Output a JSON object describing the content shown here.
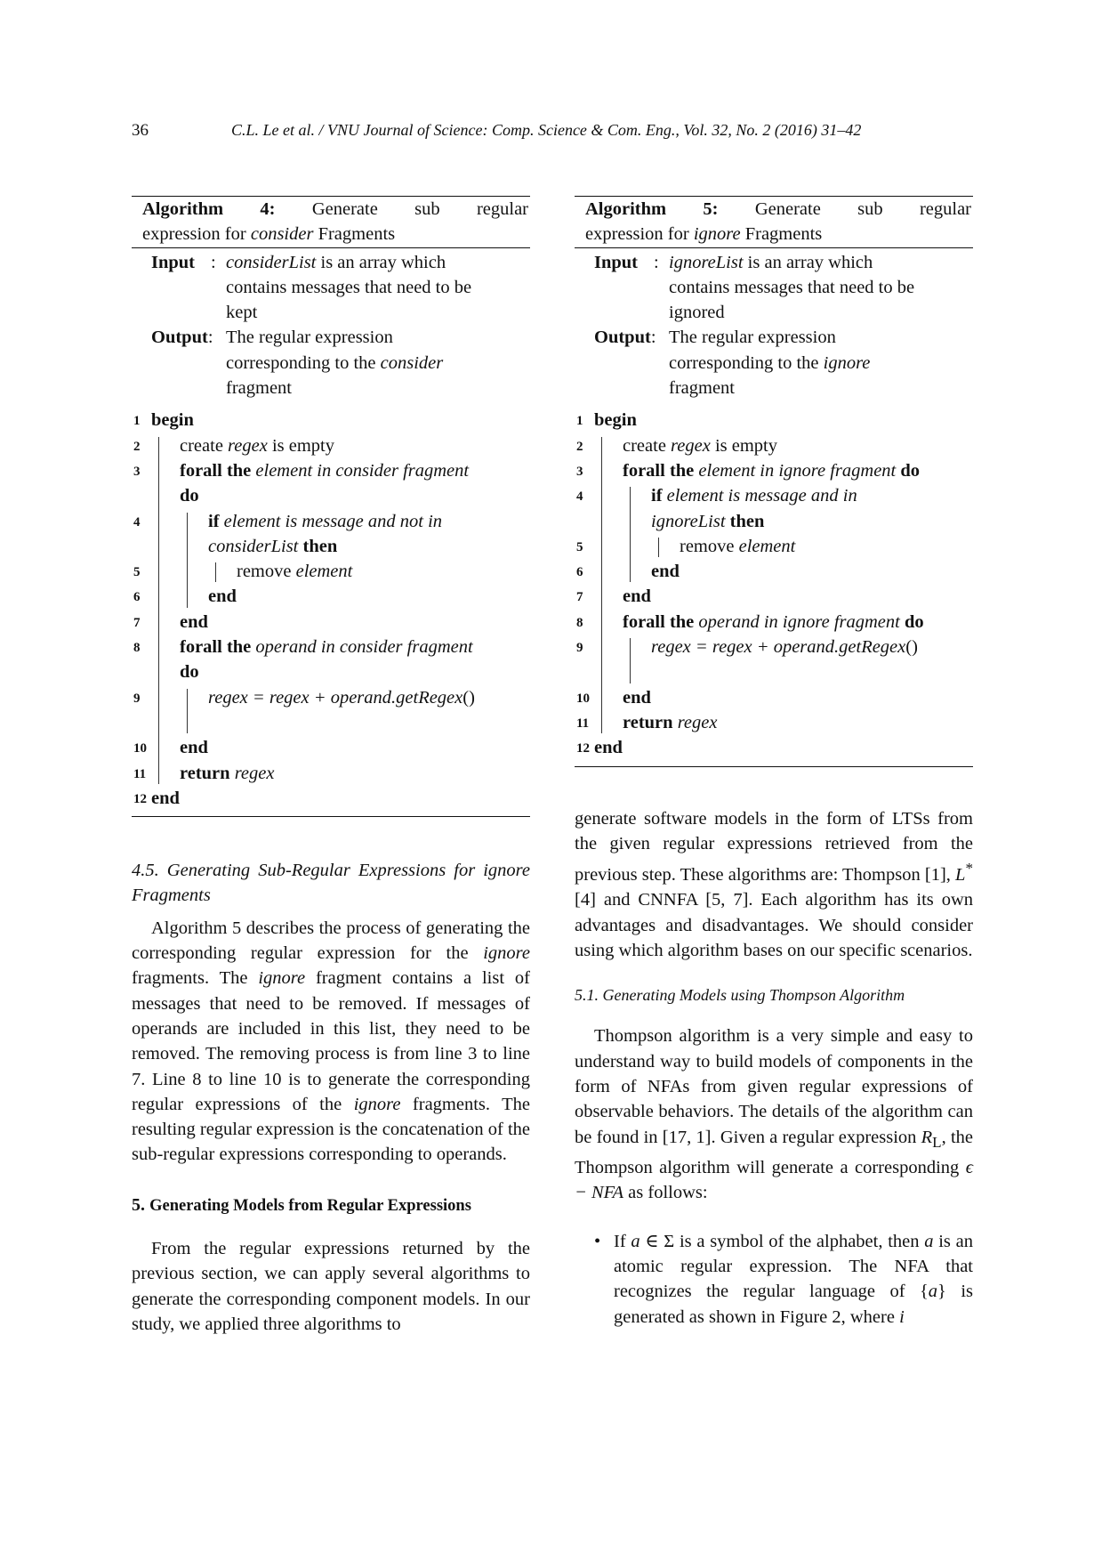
{
  "header": {
    "page_number": "36",
    "journal": "C.L. Le et al. / VNU Journal of Science: Comp. Science & Com. Eng., Vol. 32, No. 2 (2016) 31–42"
  },
  "algorithm4": {
    "label": "Algorithm 4:",
    "title_line1_words": [
      "Generate",
      "sub",
      "regular"
    ],
    "title_line2_pre": "expression for ",
    "title_line2_it": "consider",
    "title_line2_post": " Fragments",
    "input_label": "Input",
    "input_sep": ":",
    "input_it": "considerList",
    "input_text1": " is an array which",
    "input_text2": "contains messages that need to be",
    "input_text3": "kept",
    "output_label": "Output",
    "output_sep": ":",
    "output_text1": "The regular expression",
    "output_text2_pre": "corresponding to the ",
    "output_text2_it": "consider",
    "output_text3": "fragment",
    "lines": [
      {
        "n": "1",
        "kw": "begin"
      },
      {
        "n": "2",
        "pre": "create ",
        "it": "regex",
        "post": " is empty"
      },
      {
        "n": "3",
        "kw": "forall the",
        "it": " element in consider fragment"
      },
      {
        "n": "",
        "kw": "do"
      },
      {
        "n": "4",
        "kw": "if",
        "it": " element is message and not in"
      },
      {
        "n": "",
        "it": "considerList",
        "kw2": " then"
      },
      {
        "n": "5",
        "pre": "remove ",
        "it": "element"
      },
      {
        "n": "6",
        "kw": "end"
      },
      {
        "n": "7",
        "kw": "end"
      },
      {
        "n": "8",
        "kw": "forall the",
        "it": " operand in consider fragment"
      },
      {
        "n": "",
        "kw": "do"
      },
      {
        "n": "9",
        "it": "regex = regex + operand.getRegex",
        "post": "()"
      },
      {
        "n": ""
      },
      {
        "n": "10",
        "kw": "end"
      },
      {
        "n": "11",
        "kw": "return",
        "it": " regex"
      },
      {
        "n": "12",
        "kw": "end"
      }
    ]
  },
  "algorithm5": {
    "label": "Algorithm 5:",
    "title_line1_words": [
      "Generate",
      "sub",
      "regular"
    ],
    "title_line2_pre": "expression for ",
    "title_line2_it": "ignore",
    "title_line2_post": " Fragments",
    "input_label": "Input",
    "input_sep": ":",
    "input_it": "ignoreList",
    "input_text1": " is an array which",
    "input_text2": "contains messages that need to be",
    "input_text3": "ignored",
    "output_label": "Output",
    "output_sep": ":",
    "output_text1": "The regular expression",
    "output_text2_pre": "corresponding to the ",
    "output_text2_it": "ignore",
    "output_text3": "fragment",
    "lines": [
      {
        "n": "1",
        "kw": "begin"
      },
      {
        "n": "2",
        "pre": "create ",
        "it": "regex",
        "post": " is empty"
      },
      {
        "n": "3",
        "kw": "forall the",
        "it": " element in ignore fragment",
        "kw2": " do"
      },
      {
        "n": "4",
        "kw": "if",
        "it": " element is message and in"
      },
      {
        "n": "",
        "it": "ignoreList",
        "kw2": " then"
      },
      {
        "n": "5",
        "pre": "remove ",
        "it": "element"
      },
      {
        "n": "6",
        "kw": "end"
      },
      {
        "n": "7",
        "kw": "end"
      },
      {
        "n": "8",
        "kw": "forall the",
        "it": " operand in ignore fragment",
        "kw2": " do"
      },
      {
        "n": "9",
        "it": "regex = regex + operand.getRegex",
        "post": "()"
      },
      {
        "n": ""
      },
      {
        "n": "10",
        "kw": "end"
      },
      {
        "n": "11",
        "kw": "return",
        "it": " regex"
      },
      {
        "n": "12",
        "kw": "end"
      }
    ]
  },
  "section45": {
    "heading": "4.5. Generating Sub-Regular Expressions for ignore Fragments",
    "para": [
      {
        "t": "Algorithm 5 describes the process of generating the corresponding regular expression for the "
      },
      {
        "i": "ignore"
      },
      {
        "t": " fragments.  The "
      },
      {
        "i": "ignore"
      },
      {
        "t": " fragment contains a list of messages that need to be removed. If messages of operands are included in this list, they need to be removed.  The removing process is from line 3 to line 7. Line 8 to line 10 is to generate the corresponding regular expressions of the "
      },
      {
        "i": "ignore"
      },
      {
        "t": " fragments.  The resulting regular expression is the concatenation of the sub-regular expressions corresponding to operands."
      }
    ]
  },
  "section5": {
    "number": "5.",
    "heading": "Generating Models from Regular Expressions",
    "para": "From the regular expressions returned by the previous section, we can apply several algorithms to generate the corresponding component models. In our study, we applied three algorithms to"
  },
  "right_text": {
    "para1": [
      {
        "t": "generate software models in the form of LTSs from the given regular expressions retrieved from the previous step.  These algorithms are: Thompson [1], "
      },
      {
        "i": "L"
      },
      {
        "sup": "*"
      },
      {
        "t": " [4] and CNNFA [5, 7]. Each algorithm has its own advantages and disadvantages.  We should consider using which algorithm bases on our specific scenarios."
      }
    ],
    "section51": "5.1.  Generating Models using Thompson Algorithm",
    "para2": [
      {
        "t": "Thompson algorithm is a very simple and easy to understand way to build models of components in the form of NFAs from given regular expressions of observable behaviors. The details of the algorithm can be found in [17, 1]. Given a regular expression "
      },
      {
        "i": "R"
      },
      {
        "sub": "L"
      },
      {
        "t": ", the Thompson algorithm will generate a corresponding "
      },
      {
        "i": "ϵ − NFA"
      },
      {
        "t": " as follows:"
      }
    ],
    "bullet1": [
      {
        "t": "If "
      },
      {
        "i": "a"
      },
      {
        "t": " ∈ Σ is a symbol of the alphabet, then "
      },
      {
        "i": "a"
      },
      {
        "t": " is an atomic regular expression. The NFA that recognizes the regular language of {"
      },
      {
        "i": "a"
      },
      {
        "t": "} is generated as shown in Figure 2, where "
      },
      {
        "i": "i"
      }
    ]
  }
}
